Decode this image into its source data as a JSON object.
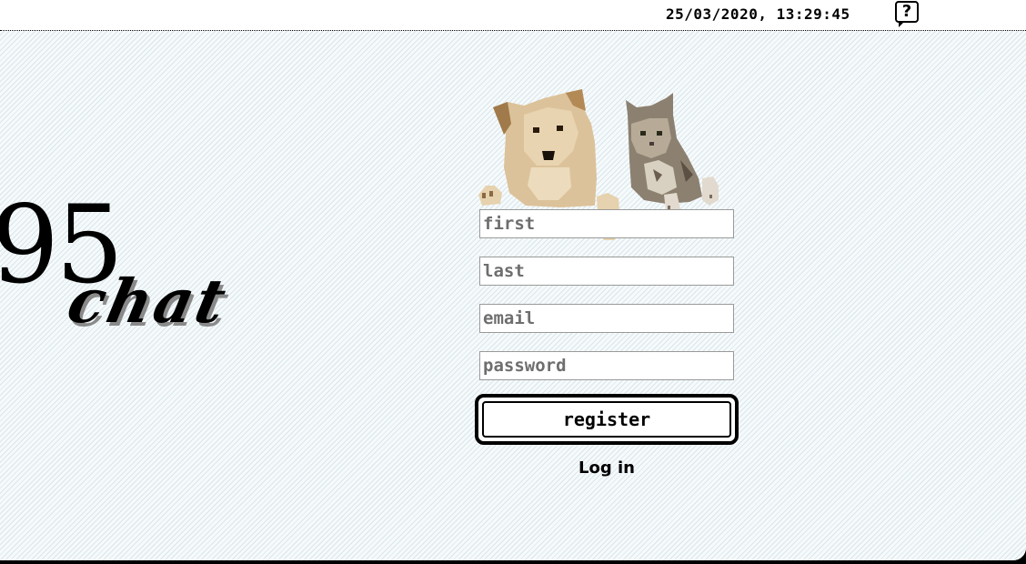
{
  "menubar": {
    "clock": "25/03/2020, 13:29:45",
    "help_label": "?"
  },
  "logo": {
    "number": "95",
    "word": "chat"
  },
  "register_form": {
    "first_placeholder": "first",
    "last_placeholder": "last",
    "email_placeholder": "email",
    "password_placeholder": "password",
    "register_label": "register",
    "login_label": "Log in"
  },
  "colors": {
    "background": "#f3f8fa",
    "stripe": "#d9e6ec",
    "text": "#000000",
    "placeholder": "#6e6e6e"
  }
}
